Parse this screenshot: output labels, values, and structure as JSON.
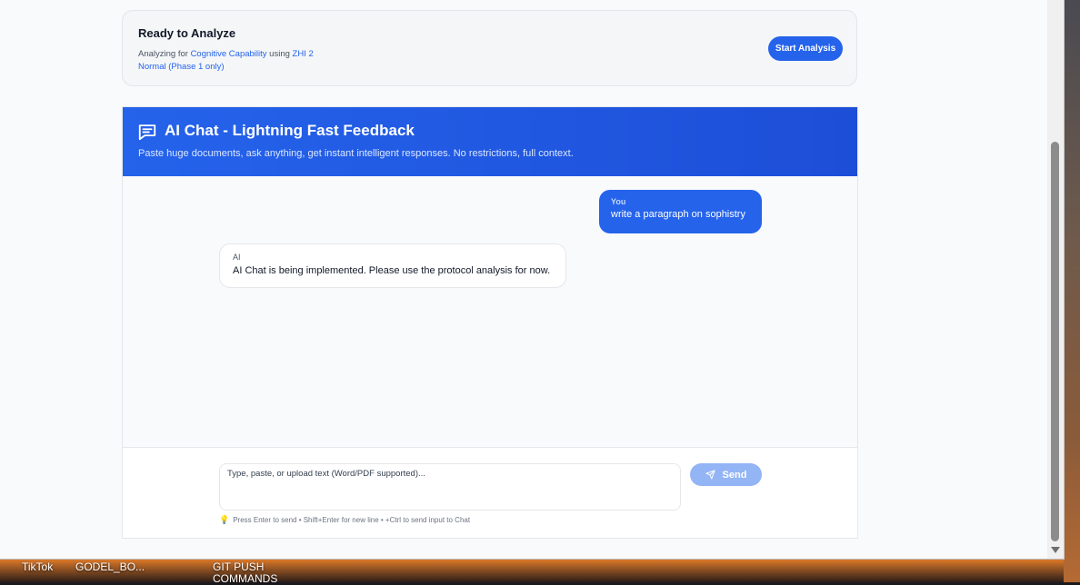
{
  "ready_card": {
    "title": "Ready to Analyze",
    "analyzing_prefix": "Analyzing for",
    "capability": "Cognitive Capability",
    "using_word": "using",
    "model": "ZHI 2",
    "mode": "Normal (Phase 1 only)",
    "start_button": "Start Analysis"
  },
  "chat": {
    "icon": "chat-bubble-icon",
    "title": "AI Chat - Lightning Fast Feedback",
    "subtitle": "Paste huge documents, ask anything, get instant intelligent responses. No restrictions, full context.",
    "messages": [
      {
        "sender": "You",
        "text": "write a paragraph on sophistry"
      },
      {
        "sender": "AI",
        "text": "AI Chat is being implemented. Please use the protocol analysis for now."
      }
    ],
    "input_placeholder": "Type, paste, or upload text (Word/PDF supported)...",
    "send_button": "Send",
    "hint": "Press Enter to send • Shift+Enter for new line • +Ctrl to send input to Chat"
  },
  "desktop": {
    "items": [
      "TikTok",
      "GODEL_BO...",
      "GIT PUSH COMMANDS"
    ]
  },
  "colors": {
    "accent": "#2563eb",
    "send_disabled": "#93b4f5",
    "page_bg": "#f9fafb"
  }
}
